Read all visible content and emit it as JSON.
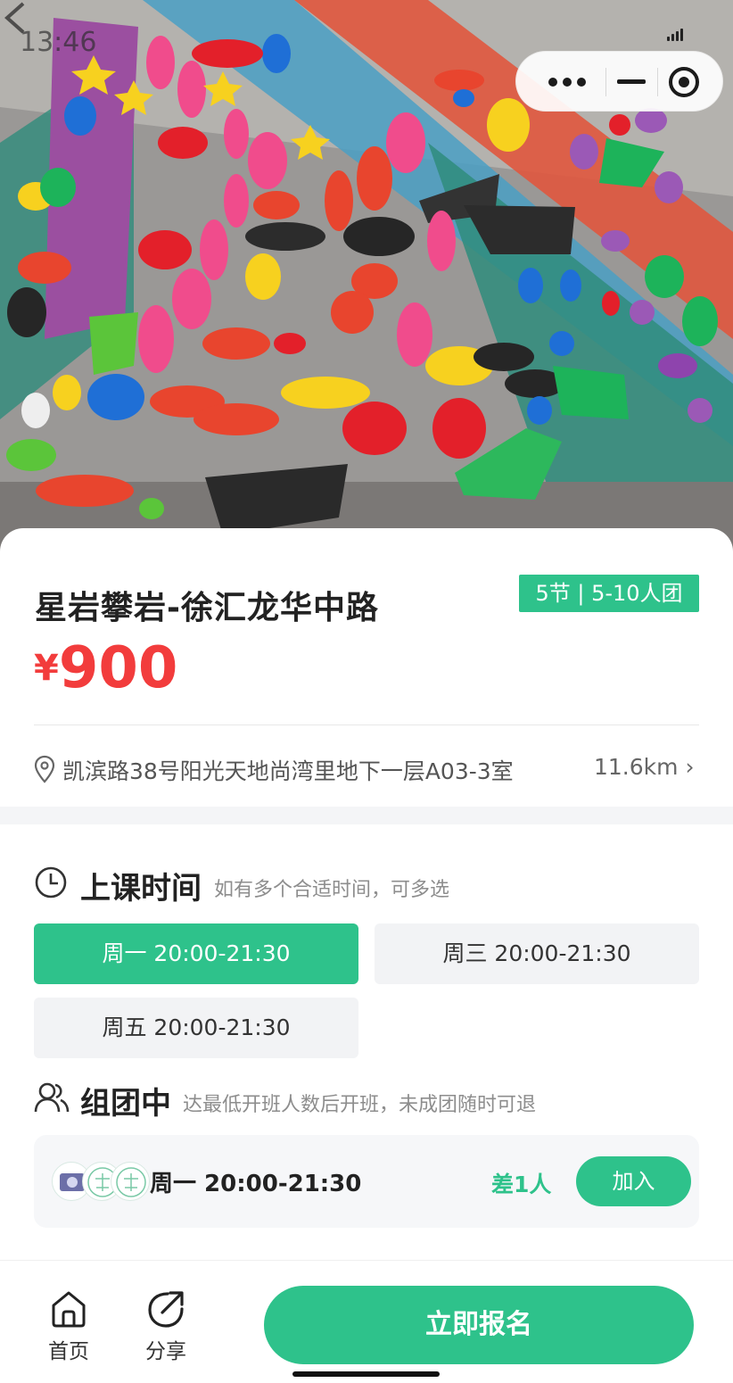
{
  "status_bar": {
    "time": "13:46"
  },
  "capsule": {
    "more_icon": "more-dots-icon",
    "minimize_icon": "minimize-icon",
    "close_icon": "miniprogram-close-icon"
  },
  "hero": {
    "image": "climbing-wall-photo"
  },
  "course": {
    "title": "星岩攀岩-徐汇龙华中路",
    "badge": "5节 | 5-10人团",
    "currency": "¥",
    "price": "900",
    "address": "凯滨路38号阳光天地尚湾里地下一层A03-3室",
    "distance": "11.6km ›"
  },
  "schedule": {
    "title": "上课时间",
    "hint": "如有多个合适时间，可多选",
    "slots": [
      {
        "label": "周一 20:00-21:30",
        "selected": true
      },
      {
        "label": "周三 20:00-21:30",
        "selected": false
      },
      {
        "label": "周五 20:00-21:30",
        "selected": false
      }
    ]
  },
  "grouping": {
    "title": "组团中",
    "hint": "达最低开班人数后开班，未成团随时可退",
    "group": {
      "time": "周一 20:00-21:30",
      "need": "差1人",
      "join_label": "加入"
    }
  },
  "bottom_bar": {
    "home_label": "首页",
    "share_label": "分享",
    "signup_label": "立即报名"
  },
  "colors": {
    "accent": "#2ec28b",
    "price": "#f23c3c"
  }
}
